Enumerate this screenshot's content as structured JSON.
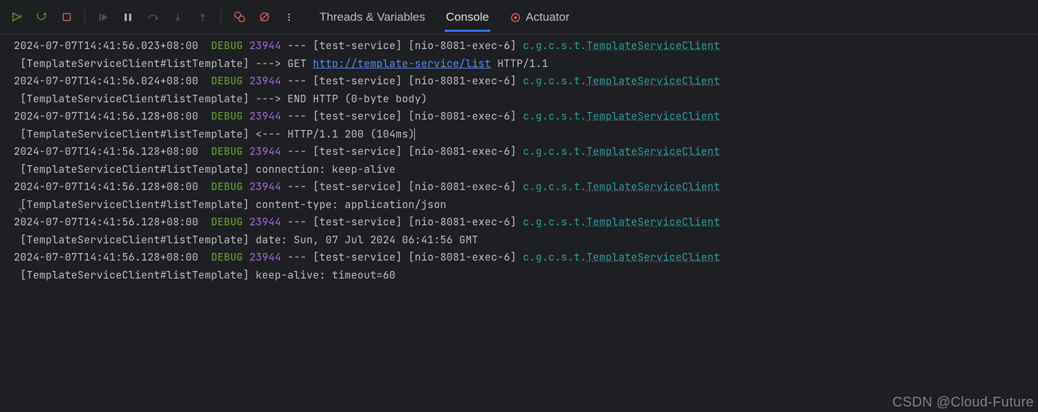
{
  "toolbar": {
    "rerun_icon": "rerun",
    "rerun2_icon": "rerun-dbg",
    "stop_icon": "stop",
    "resume_icon": "resume",
    "pause_icon": "pause",
    "stepover_icon": "step-over",
    "stepinto_icon": "step-into",
    "stepout_icon": "step-out",
    "frames_icon": "view-bp",
    "mute_icon": "mute-bp",
    "more_icon": "more"
  },
  "tabs": {
    "threads": "Threads & Variables",
    "console": "Console",
    "actuator": "Actuator"
  },
  "log": {
    "sep": " --- ",
    "colon": " : ",
    "lines": [
      {
        "ts": "2024-07-07T14:41:56.023+08:00",
        "lvl": "DEBUG",
        "pid": "23944",
        "svc": "[test-service]",
        "thr": "[nio-8081-exec-6]",
        "pkg": "c.g.c.s.t.",
        "cls": "TemplateServiceClient",
        "cont": " [TemplateServiceClient#listTemplate] ---> GET ",
        "link": "http://template-service/list",
        "tail": " HTTP/1.1"
      },
      {
        "ts": "2024-07-07T14:41:56.024+08:00",
        "lvl": "DEBUG",
        "pid": "23944",
        "svc": "[test-service]",
        "thr": "[nio-8081-exec-6]",
        "pkg": "c.g.c.s.t.",
        "cls": "TemplateServiceClient",
        "cont": " [TemplateServiceClient#listTemplate] ---> END HTTP (0-byte body)"
      },
      {
        "ts": "2024-07-07T14:41:56.128+08:00",
        "lvl": "DEBUG",
        "pid": "23944",
        "svc": "[test-service]",
        "thr": "[nio-8081-exec-6]",
        "pkg": "c.g.c.s.t.",
        "cls": "TemplateServiceClient",
        "cont": " [TemplateServiceClient#listTemplate] <--- HTTP/1.1 200 (104ms)",
        "cursor": true
      },
      {
        "ts": "2024-07-07T14:41:56.128+08:00",
        "lvl": "DEBUG",
        "pid": "23944",
        "svc": "[test-service]",
        "thr": "[nio-8081-exec-6]",
        "pkg": "c.g.c.s.t.",
        "cls": "TemplateServiceClient",
        "cont": " [TemplateServiceClient#listTemplate] connection: keep-alive"
      },
      {
        "ts": "2024-07-07T14:41:56.128+08:00",
        "lvl": "DEBUG",
        "pid": "23944",
        "svc": "[test-service]",
        "thr": "[nio-8081-exec-6]",
        "pkg": "c.g.c.s.t.",
        "cls": "TemplateServiceClient",
        "cont": " [TemplateServiceClient#listTemplate] content-type: application/json"
      },
      {
        "ts": "2024-07-07T14:41:56.128+08:00",
        "lvl": "DEBUG",
        "pid": "23944",
        "svc": "[test-service]",
        "thr": "[nio-8081-exec-6]",
        "pkg": "c.g.c.s.t.",
        "cls": "TemplateServiceClient",
        "cont": " [TemplateServiceClient#listTemplate] date: Sun, 07 Jul 2024 06:41:56 GMT"
      },
      {
        "ts": "2024-07-07T14:41:56.128+08:00",
        "lvl": "DEBUG",
        "pid": "23944",
        "svc": "[test-service]",
        "thr": "[nio-8081-exec-6]",
        "pkg": "c.g.c.s.t.",
        "cls": "TemplateServiceClient",
        "cont": " [TemplateServiceClient#listTemplate] keep-alive: timeout=60"
      }
    ]
  },
  "watermark": "CSDN @Cloud-Future"
}
